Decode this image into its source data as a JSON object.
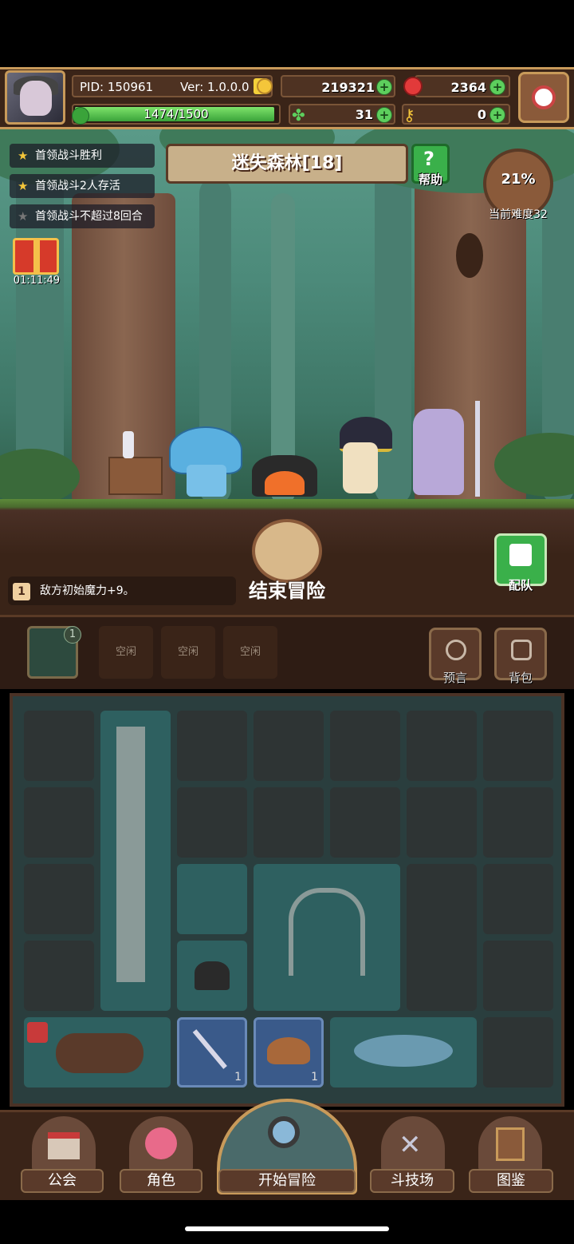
{
  "player": {
    "pid": "PID: 150961",
    "version": "Ver: 1.0.0.0",
    "exp": "1474/1500",
    "exp_fraction": 0.983
  },
  "currencies": {
    "gold": "219321",
    "gem": "2364",
    "clover": "31",
    "key": "0"
  },
  "quests": [
    {
      "label": "首领战斗胜利",
      "done": true
    },
    {
      "label": "首领战斗2人存活",
      "done": true
    },
    {
      "label": "首领战斗不超过8回合",
      "done": false
    }
  ],
  "gift": {
    "timer": "01:11:49"
  },
  "stage": {
    "title": "迷失森林[18]",
    "help_label": "帮助"
  },
  "difficulty": {
    "percent": "21%",
    "label": "当前难度32"
  },
  "actions": {
    "end_label": "结束冒险",
    "team_label": "配队"
  },
  "buff": {
    "number": "1",
    "text": "敌方初始魔力+9。"
  },
  "slots": {
    "badge": "1",
    "idle": [
      "空闲",
      "空闲",
      "空闲"
    ],
    "prophecy_label": "预言",
    "bag_label": "背包"
  },
  "grid_counts": [
    "1",
    "1"
  ],
  "nav": {
    "guild": "公会",
    "character": "角色",
    "start": "开始冒险",
    "arena": "斗技场",
    "codex": "图鉴"
  },
  "colors": {
    "frame": "#c89a5a",
    "panel": "#3a2418",
    "exp_green": "#5dcf5d",
    "quest_star": "#f4c63a"
  }
}
